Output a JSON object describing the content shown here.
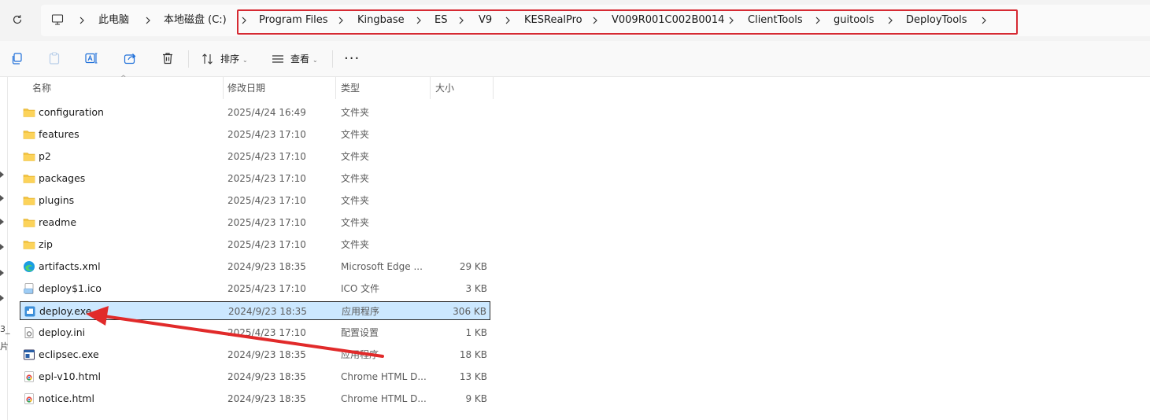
{
  "address_bar": {
    "pc_label": "此电脑",
    "drive_label": "本地磁盘 (C:)",
    "path": [
      "Program Files",
      "Kingbase",
      "ES",
      "V9",
      "KESRealPro",
      "V009R001C002B0014",
      "ClientTools",
      "guitools",
      "DeployTools"
    ]
  },
  "toolbar": {
    "sort_label": "排序",
    "view_label": "查看",
    "more_label": "···"
  },
  "columns": {
    "name": "名称",
    "date": "修改日期",
    "type": "类型",
    "size": "大小"
  },
  "files": [
    {
      "name": "configuration",
      "date": "2025/4/24 16:49",
      "type": "文件夹",
      "size": "",
      "icon": "folder-icon"
    },
    {
      "name": "features",
      "date": "2025/4/23 17:10",
      "type": "文件夹",
      "size": "",
      "icon": "folder-icon"
    },
    {
      "name": "p2",
      "date": "2025/4/23 17:10",
      "type": "文件夹",
      "size": "",
      "icon": "folder-icon"
    },
    {
      "name": "packages",
      "date": "2025/4/23 17:10",
      "type": "文件夹",
      "size": "",
      "icon": "folder-icon"
    },
    {
      "name": "plugins",
      "date": "2025/4/23 17:10",
      "type": "文件夹",
      "size": "",
      "icon": "folder-icon"
    },
    {
      "name": "readme",
      "date": "2025/4/23 17:10",
      "type": "文件夹",
      "size": "",
      "icon": "folder-icon"
    },
    {
      "name": "zip",
      "date": "2025/4/23 17:10",
      "type": "文件夹",
      "size": "",
      "icon": "folder-icon"
    },
    {
      "name": "artifacts.xml",
      "date": "2024/9/23 18:35",
      "type": "Microsoft Edge ...",
      "size": "29 KB",
      "icon": "edge-icon"
    },
    {
      "name": "deploy$1.ico",
      "date": "2025/4/23 17:10",
      "type": "ICO 文件",
      "size": "3 KB",
      "icon": "ico-file-icon"
    },
    {
      "name": "deploy.exe",
      "date": "2024/9/23 18:35",
      "type": "应用程序",
      "size": "306 KB",
      "icon": "exe-app-icon",
      "selected": true
    },
    {
      "name": "deploy.ini",
      "date": "2025/4/23 17:10",
      "type": "配置设置",
      "size": "1 KB",
      "icon": "ini-file-icon"
    },
    {
      "name": "eclipsec.exe",
      "date": "2024/9/23 18:35",
      "type": "应用程序",
      "size": "18 KB",
      "icon": "console-exe-icon"
    },
    {
      "name": "epl-v10.html",
      "date": "2024/9/23 18:35",
      "type": "Chrome HTML D...",
      "size": "13 KB",
      "icon": "chrome-icon"
    },
    {
      "name": "notice.html",
      "date": "2024/9/23 18:35",
      "type": "Chrome HTML D...",
      "size": "9 KB",
      "icon": "chrome-icon"
    }
  ],
  "left_pane_fragments": [
    "3_",
    "片"
  ],
  "colors": {
    "selection_bg": "#cce8ff",
    "annotation_red": "#d62a33",
    "folder_yellow": "#f4c542"
  }
}
